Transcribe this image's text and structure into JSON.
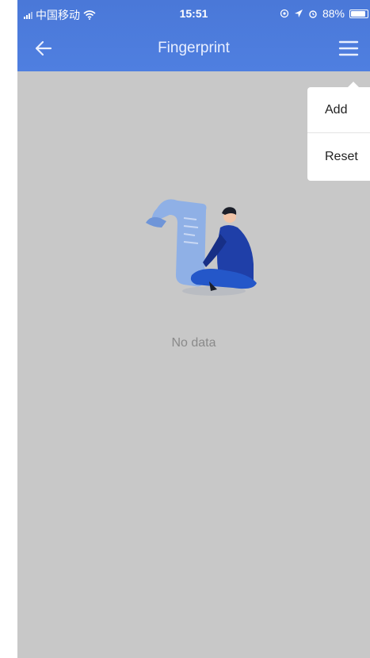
{
  "status_bar": {
    "carrier": "中国移动",
    "time": "15:51",
    "battery": "88%"
  },
  "navbar": {
    "title": "Fingerprint"
  },
  "dropdown": {
    "items": [
      {
        "label": "Add"
      },
      {
        "label": "Reset"
      }
    ]
  },
  "empty_state": {
    "message": "No data"
  },
  "colors": {
    "header_blue": "#4f7fe0",
    "background_gray": "#c8c8c8",
    "illustration_blue": "#1f3fa8"
  },
  "icons": [
    "signal-icon",
    "wifi-icon",
    "location-icon",
    "alarm-icon",
    "battery-icon",
    "back-arrow-icon",
    "menu-icon"
  ]
}
